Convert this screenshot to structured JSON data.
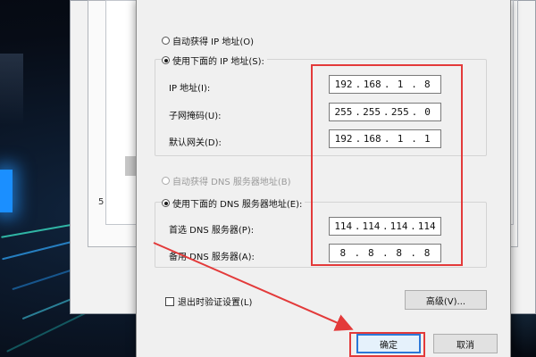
{
  "dialog": {
    "auto_ip_label": "自动获得 IP 地址(O)",
    "manual_ip_label": "使用下面的 IP 地址(S):",
    "ip_label": "IP 地址(I):",
    "subnet_label": "子网掩码(U):",
    "gateway_label": "默认网关(D):",
    "auto_dns_label": "自动获得 DNS 服务器地址(B)",
    "manual_dns_label": "使用下面的 DNS 服务器地址(E):",
    "preferred_dns_label": "首选 DNS 服务器(P):",
    "alternate_dns_label": "备用 DNS 服务器(A):",
    "validate_on_exit_label": "退出时验证设置(L)",
    "advanced_button": "高级(V)...",
    "ok_button": "确定",
    "cancel_button": "取消",
    "ip_mode_selected": "manual",
    "dns_mode_selected": "manual",
    "validate_on_exit_checked": false
  },
  "fields": {
    "ip_address": [
      "192",
      "168",
      "1",
      "8"
    ],
    "subnet_mask": [
      "255",
      "255",
      "255",
      "0"
    ],
    "default_gateway": [
      "192",
      "168",
      "1",
      "1"
    ],
    "preferred_dns": [
      "114",
      "114",
      "114",
      "114"
    ],
    "alternate_dns": [
      "8",
      "8",
      "8",
      "8"
    ]
  },
  "background": {
    "behind_label": "5"
  },
  "colors": {
    "annotation_red": "#e33a3a",
    "default_button_border": "#2b78d8",
    "dialog_bg": "#f0f0f0"
  }
}
